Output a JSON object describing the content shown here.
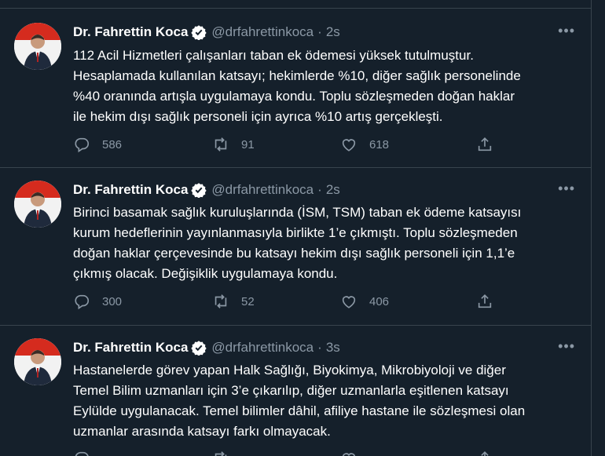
{
  "tweets": [
    {
      "name": "Dr. Fahrettin Koca",
      "handle": "@drfahrettinkoca",
      "dot": "·",
      "time": "2s",
      "more": "•••",
      "lines": [
        "112 Acil Hizmetleri çalışanları taban ek ödemesi yüksek tutulmuştur.",
        "Hesaplamada kullanılan katsayı; hekimlerde %10, diğer sağlık personelinde",
        "%40 oranında artışla uygulamaya kondu. Toplu sözleşmeden doğan haklar",
        "ile hekim dışı sağlık personeli için ayrıca %10 artış gerçekleşti."
      ],
      "replies": "586",
      "retweets": "91",
      "likes": "618"
    },
    {
      "name": "Dr. Fahrettin Koca",
      "handle": "@drfahrettinkoca",
      "dot": "·",
      "time": "2s",
      "more": "•••",
      "lines": [
        "Birinci basamak sağlık kuruluşlarında (İSM, TSM) taban ek ödeme katsayısı",
        "kurum hedeflerinin yayınlanmasıyla birlikte 1’e çıkmıştı. Toplu sözleşmeden",
        "doğan haklar çerçevesinde bu katsayı hekim dışı sağlık personeli için 1,1’e",
        "çıkmış olacak. Değişiklik uygulamaya kondu."
      ],
      "replies": "300",
      "retweets": "52",
      "likes": "406"
    },
    {
      "name": "Dr. Fahrettin Koca",
      "handle": "@drfahrettinkoca",
      "dot": "·",
      "time": "3s",
      "more": "•••",
      "lines": [
        "Hastanelerde görev yapan Halk Sağlığı, Biyokimya, Mikrobiyoloji ve diğer",
        "Temel Bilim uzmanları için 3’e çıkarılıp, diğer uzmanlarla eşitlenen katsayı",
        "Eylülde uygulanacak. Temel bilimler dâhil, afiliye hastane ile sözleşmesi olan",
        "uzmanlar arasında katsayı farkı olmayacak."
      ],
      "replies": "",
      "retweets": "",
      "likes": ""
    }
  ],
  "colors": {
    "background": "#15202b",
    "border": "#38444d",
    "text": "#ffffff",
    "muted": "#8b98a5",
    "verified": "#ffffff"
  },
  "icons": {
    "reply": "reply-icon",
    "retweet": "retweet-icon",
    "like": "heart-icon",
    "share": "share-icon",
    "verified": "verified-badge-icon",
    "more": "more-icon"
  }
}
